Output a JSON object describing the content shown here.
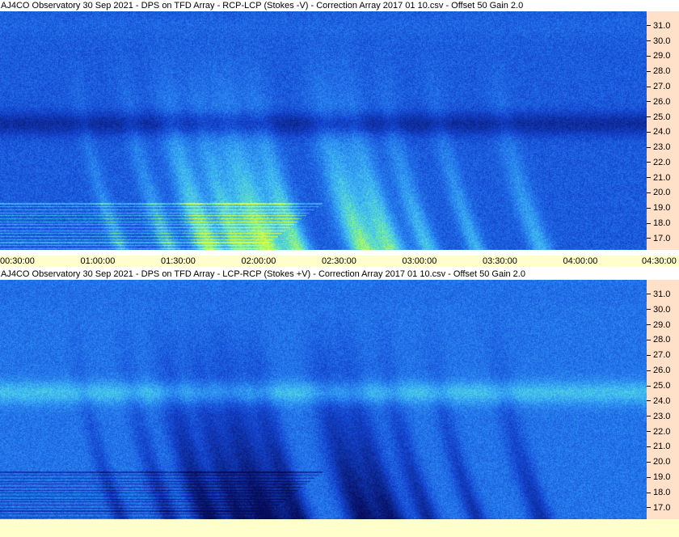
{
  "panels": [
    {
      "title": "AJ4CO Observatory 30 Sep 2021  -  DPS on TFD Array  -  RCP-LCP (Stokes -V)  -  Correction Array 2017 01 10.csv  -  Offset 50  Gain 2.0",
      "mode": "stokes-minus-v"
    },
    {
      "title": "AJ4CO Observatory 30 Sep 2021  -  DPS on TFD Array  -  LCP-RCP (Stokes +V)  -  Correction Array 2017 01 10.csv  -  Offset 50  Gain 2.0",
      "mode": "stokes-plus-v"
    }
  ],
  "chart_data": [
    {
      "type": "heatmap",
      "title": "AJ4CO Observatory 30 Sep 2021  -  DPS on TFD Array  -  RCP-LCP (Stokes -V)  -  Correction Array 2017 01 10.csv  -  Offset 50  Gain 2.0",
      "x_tick_labels": [
        "00:30:00",
        "01:00:00",
        "01:30:00",
        "02:00:00",
        "02:30:00",
        "03:00:00",
        "03:30:00",
        "04:00:00",
        "04:30:00"
      ],
      "y_tick_labels": [
        "31.0",
        "30.0",
        "29.0",
        "28.0",
        "27.0",
        "26.0",
        "25.0",
        "24.0",
        "23.0",
        "22.0",
        "21.0",
        "20.0",
        "19.0",
        "18.0",
        "17.0"
      ],
      "xlim": [
        "00:30:00",
        "04:30:00"
      ],
      "ylim": [
        16.3,
        32.0
      ],
      "colors": {
        "low": "#0a1e8c",
        "mid": "#1e78e6",
        "high": "#c8ff3c"
      }
    },
    {
      "type": "heatmap",
      "title": "AJ4CO Observatory 30 Sep 2021  -  DPS on TFD Array  -  LCP-RCP (Stokes +V)  -  Correction Array 2017 01 10.csv  -  Offset 50  Gain 2.0",
      "y_tick_labels": [
        "31.0",
        "30.0",
        "29.0",
        "28.0",
        "27.0",
        "26.0",
        "25.0",
        "24.0",
        "23.0",
        "22.0",
        "21.0",
        "20.0",
        "19.0",
        "18.0",
        "17.0"
      ],
      "ylim": [
        16.3,
        32.0
      ],
      "colors": {
        "low": "#060c5a",
        "mid": "#1e78e6",
        "high": "#50e6e6"
      }
    }
  ]
}
